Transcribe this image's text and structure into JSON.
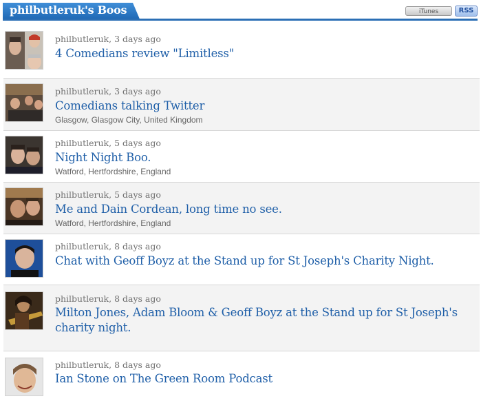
{
  "header": {
    "title": "philbutleruk's Boos",
    "itunes_label": "iTunes",
    "rss_label": "RSS"
  },
  "boos": [
    {
      "user": "philbutleruk",
      "time": ", 3 days ago",
      "title": "4 Comedians review \"Limitless\"",
      "location": "",
      "avatar": "four-faces"
    },
    {
      "user": "philbutleruk",
      "time": ", 3 days ago",
      "title": "Comedians talking Twitter",
      "location": "Glasgow, Glasgow City, United Kingdom",
      "avatar": "group-pub"
    },
    {
      "user": "philbutleruk",
      "time": ", 5 days ago",
      "title": "Night Night Boo.",
      "location": "Watford, Hertfordshire, England",
      "avatar": "two-men"
    },
    {
      "user": "philbutleruk",
      "time": ", 5 days ago",
      "title": "Me and Dain Cordean, long time no see.",
      "location": "Watford, Hertfordshire, England",
      "avatar": "two-men-dark"
    },
    {
      "user": "philbutleruk",
      "time": ", 8 days ago",
      "title": "Chat with Geoff Boyz at the Stand up for St Joseph's Charity Night.",
      "location": "",
      "avatar": "man-blue"
    },
    {
      "user": "philbutleruk",
      "time": ", 8 days ago",
      "title": "Milton Jones, Adam Bloom & Geoff Boyz at the Stand up for St Joseph's charity night.",
      "location": "",
      "avatar": "guitar-man"
    },
    {
      "user": "philbutleruk",
      "time": ", 8 days ago",
      "title": "Ian Stone on The Green Room Podcast",
      "location": "",
      "avatar": "smiling-man"
    }
  ]
}
